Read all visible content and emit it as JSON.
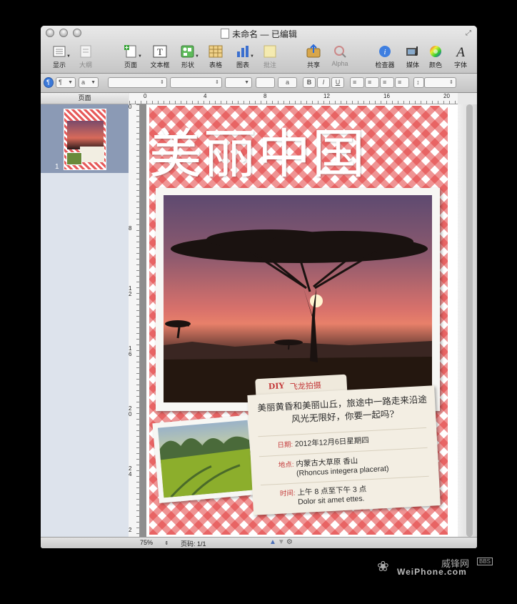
{
  "window": {
    "title": "未命名 — 已编辑"
  },
  "toolbar": {
    "view": "显示",
    "outline": "大纲",
    "pages": "页面",
    "textbox": "文本框",
    "shapes": "形状",
    "table": "表格",
    "chart": "图表",
    "comment": "批注",
    "share": "共享",
    "alpha": "Alpha",
    "inspector": "检查器",
    "media": "媒体",
    "colors": "颜色",
    "fonts": "字体"
  },
  "formatbar": {
    "b": "B",
    "i": "I",
    "u": "U",
    "para": "¶",
    "style": "a",
    "font_color": "a"
  },
  "sidebar": {
    "header": "页面",
    "page_number": "1"
  },
  "ruler": {
    "h": [
      "0",
      "4",
      "8",
      "12",
      "16",
      "20"
    ],
    "v": [
      "0",
      "8",
      "12",
      "16",
      "20",
      "24",
      "2"
    ]
  },
  "doc": {
    "title": "美丽中国",
    "card": {
      "tab_diy": "DIY",
      "tab_text": "飞龙拍摄",
      "lead": "美丽黄昏和美丽山丘，旅途中一路走来沿途风光无限好，你要一起吗?",
      "date_label": "日期:",
      "date_value": "2012年12月6日星期四",
      "place_label": "地点:",
      "place_value1": "内蒙古大草原 香山",
      "place_value2": "(Rhoncus integera placerat)",
      "time_label": "时间:",
      "time_value1": "上午 8 点至下午 3 点",
      "time_value2": "Dolor sit amet ettes."
    }
  },
  "status": {
    "zoom": "75%",
    "page": "页码:  1/1"
  },
  "watermark": {
    "cn": "威锋网",
    "bbs": "BBS",
    "en": "WeiPhone.com"
  },
  "colors": {
    "gingham": "#e23c3c",
    "accent_text": "#c43a3a",
    "card": "#f3eee3"
  }
}
